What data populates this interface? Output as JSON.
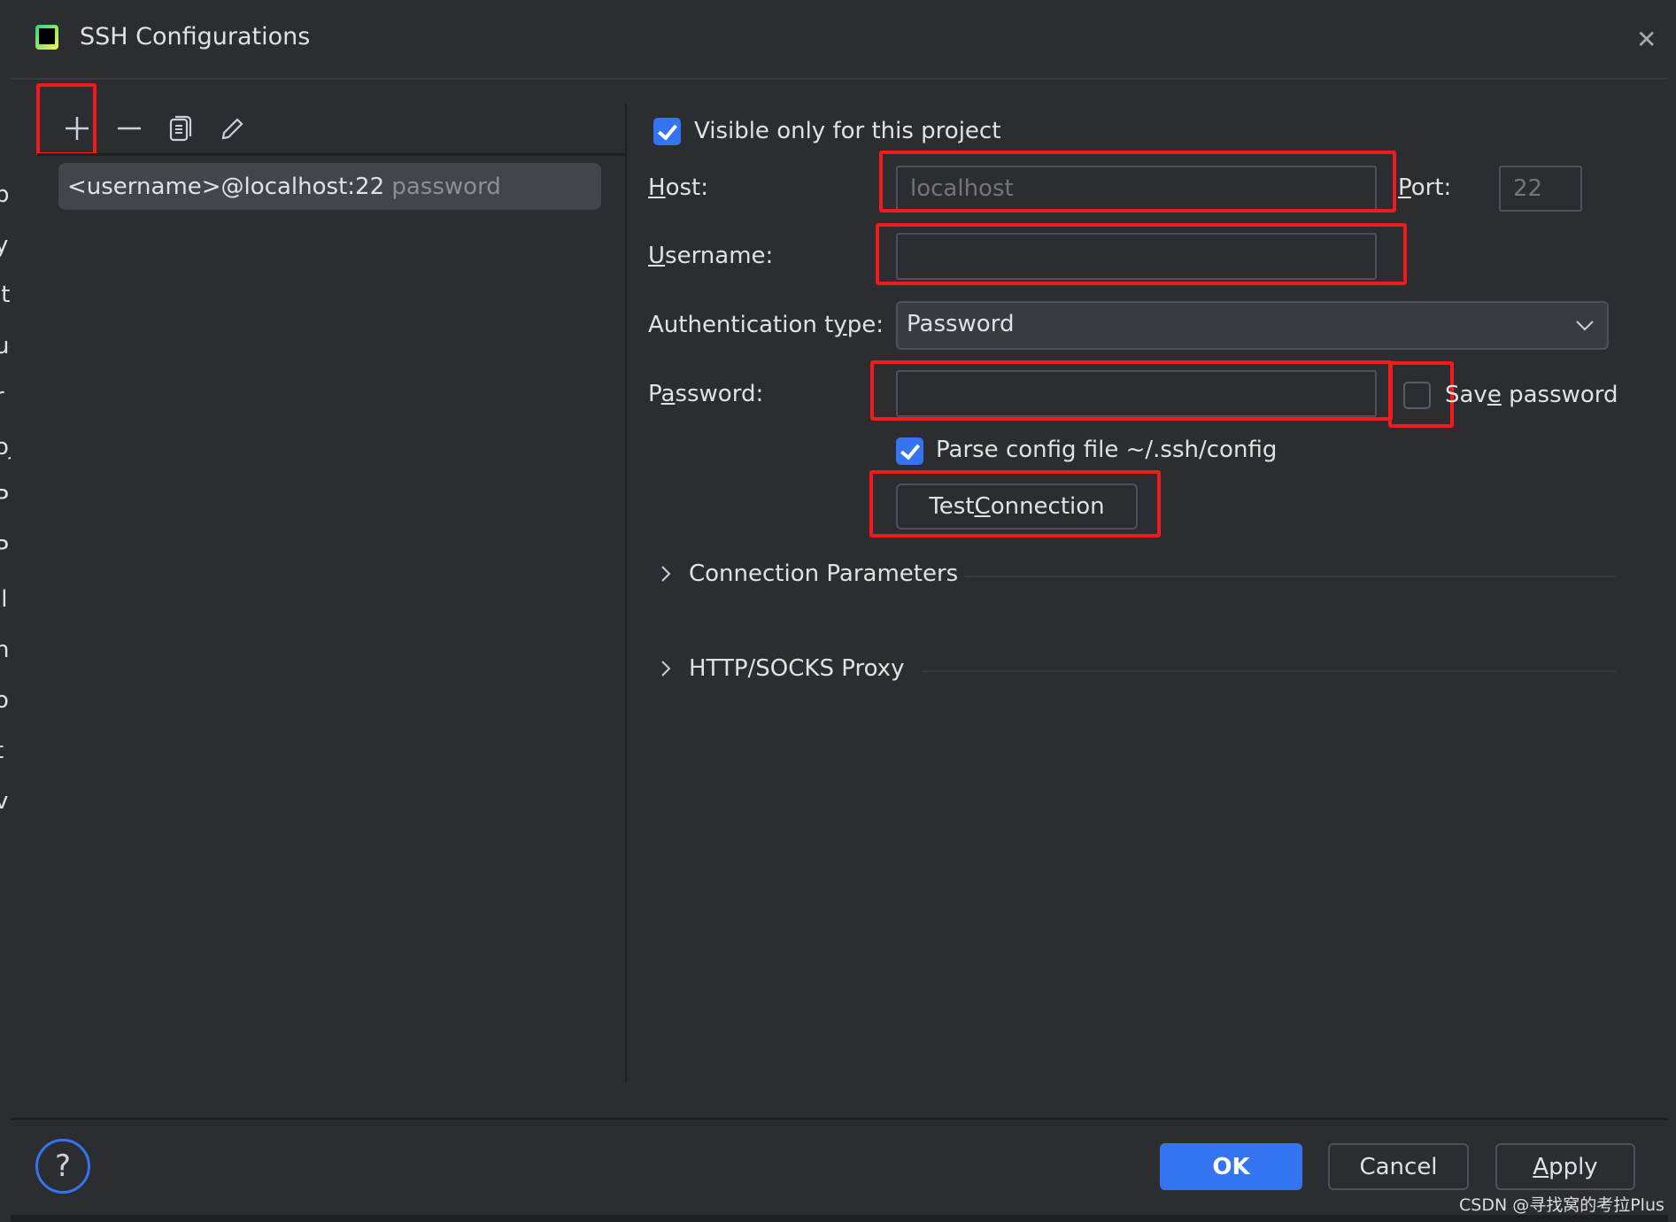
{
  "background_fragments": [
    "p",
    "y",
    "it",
    "ug",
    "r",
    "oj",
    "P",
    "P",
    "il",
    "n",
    "o",
    "t",
    "v"
  ],
  "dialog": {
    "title": "SSH Configurations",
    "close_icon": "close-icon"
  },
  "toolbar": {
    "add": "plus-icon",
    "remove": "minus-icon",
    "copy": "copy-icon",
    "edit": "pencil-icon"
  },
  "list": {
    "items": [
      {
        "label": "<username>@localhost:22",
        "sub": "password"
      }
    ]
  },
  "form": {
    "visible_only": {
      "label": "Visible only for this project",
      "checked": true
    },
    "host": {
      "label": {
        "pre": "",
        "key": "H",
        "post": "ost:"
      },
      "value": "",
      "placeholder": "localhost"
    },
    "port": {
      "label": {
        "pre": "",
        "key": "P",
        "post": "ort:"
      },
      "placeholder": "22"
    },
    "username": {
      "label": {
        "pre": "",
        "key": "U",
        "post": "sername:"
      },
      "value": ""
    },
    "auth_type": {
      "label": {
        "pre": "Authentication t",
        "key": "y",
        "post": "pe:"
      },
      "value": "Password"
    },
    "password": {
      "label": {
        "pre": "P",
        "key": "a",
        "post": "ssword:"
      },
      "value": ""
    },
    "save_password": {
      "label": {
        "pre": "Sav",
        "key": "e",
        "post": " password"
      },
      "checked": false
    },
    "parse_config": {
      "label": "Parse config file ~/.ssh/config",
      "checked": true
    },
    "test_connection": {
      "pre": "Test ",
      "key": "C",
      "post": "onnection"
    },
    "sections": [
      "Connection Parameters",
      "HTTP/SOCKS Proxy"
    ]
  },
  "footer": {
    "help": "?",
    "ok": "OK",
    "cancel": "Cancel",
    "apply": {
      "pre": "",
      "key": "A",
      "post": "pply"
    }
  },
  "watermark": "CSDN @寻找窝的考拉Plus",
  "colors": {
    "accent": "#3574f0",
    "highlight": "#f21b1b",
    "background": "#2b2d30"
  }
}
